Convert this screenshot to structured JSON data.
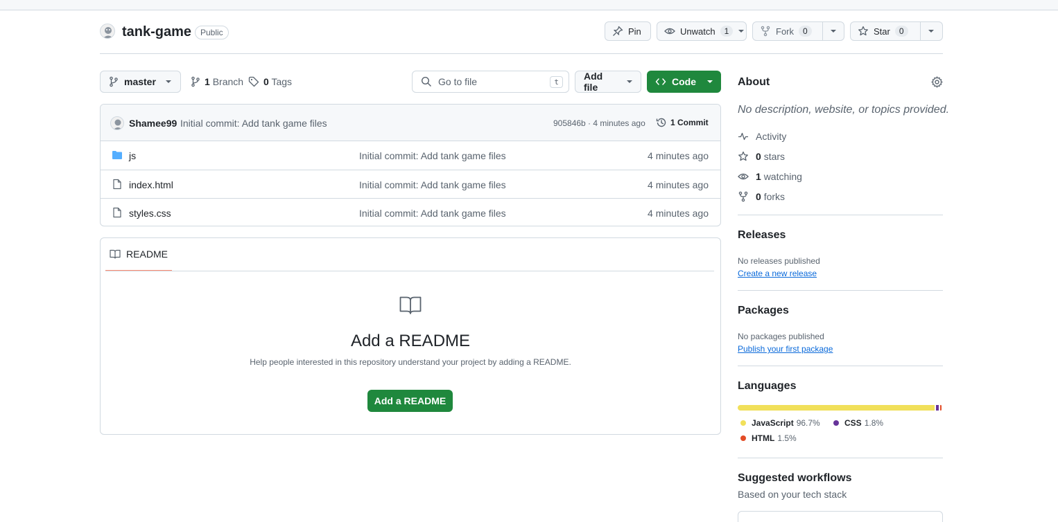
{
  "repo": {
    "name": "tank-game",
    "visibility": "Public",
    "actions": {
      "pin": "Pin",
      "unwatch": "Unwatch",
      "unwatch_count": "1",
      "fork": "Fork",
      "fork_count": "0",
      "star": "Star",
      "star_count": "0"
    }
  },
  "toolbar": {
    "branch": "master",
    "branches_count": "1",
    "branches_label": "Branch",
    "tags_count": "0",
    "tags_label": "Tags",
    "go_to_file_placeholder": "Go to file",
    "go_to_file_shortcut": "t",
    "add_file": "Add file",
    "code": "Code"
  },
  "commit": {
    "author": "Shamee99",
    "message": "Initial commit: Add tank game files",
    "meta": "905846b · 4 minutes ago",
    "commits_label": "1 Commit"
  },
  "files": [
    {
      "name": "js",
      "type": "folder",
      "message": "Initial commit: Add tank game files",
      "time": "4 minutes ago"
    },
    {
      "name": "index.html",
      "type": "file",
      "message": "Initial commit: Add tank game files",
      "time": "4 minutes ago"
    },
    {
      "name": "styles.css",
      "type": "file",
      "message": "Initial commit: Add tank game files",
      "time": "4 minutes ago"
    }
  ],
  "readme": {
    "tab": "README",
    "heading": "Add a README",
    "description": "Help people interested in this repository understand your project by adding a README.",
    "button": "Add a README"
  },
  "about": {
    "title": "About",
    "description": "No description, website, or topics provided.",
    "activity": "Activity",
    "stars_count": "0",
    "stars_label": "stars",
    "watching_count": "1",
    "watching_label": "watching",
    "forks_count": "0",
    "forks_label": "forks"
  },
  "releases": {
    "title": "Releases",
    "empty": "No releases published",
    "link": "Create a new release"
  },
  "packages": {
    "title": "Packages",
    "empty": "No packages published",
    "link": "Publish your first package"
  },
  "languages": {
    "title": "Languages",
    "items": [
      {
        "name": "JavaScript",
        "percent": "96.7%",
        "value": 96.7,
        "color": "#f1e05a"
      },
      {
        "name": "CSS",
        "percent": "1.8%",
        "value": 1.8,
        "color": "#663399"
      },
      {
        "name": "HTML",
        "percent": "1.5%",
        "value": 1.5,
        "color": "#e34c26"
      }
    ]
  },
  "workflows": {
    "title": "Suggested workflows",
    "subtitle": "Based on your tech stack"
  },
  "colors": {
    "primary_green": "#1f883d",
    "link_blue": "#0969da",
    "folder_blue": "#54aeff",
    "readme_tab_underline": "#fd8c73"
  }
}
